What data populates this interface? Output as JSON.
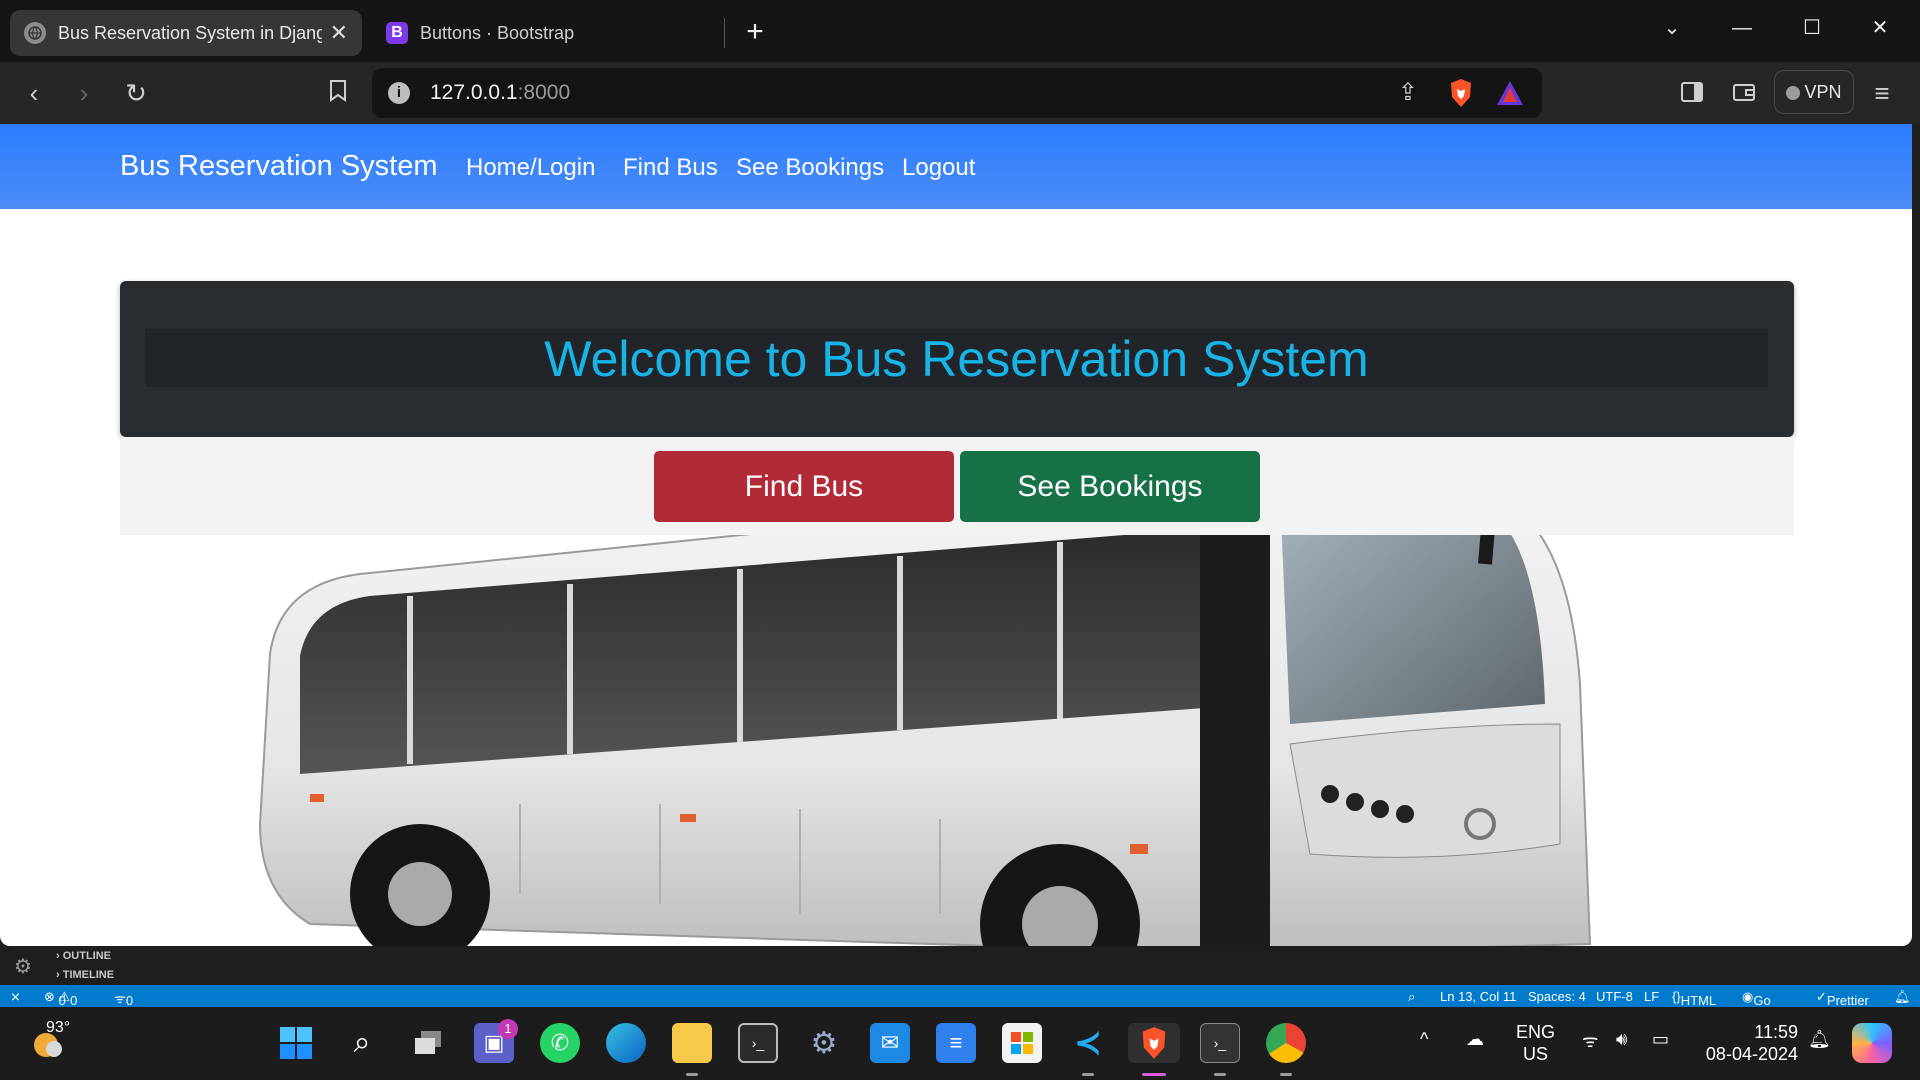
{
  "browser": {
    "tabs": [
      {
        "title": "Bus Reservation System in Djang",
        "active": true
      },
      {
        "title": "Buttons · Bootstrap",
        "active": false
      }
    ],
    "url_host": "127.0.0.1",
    "url_port": ":8000",
    "vpn_label": "VPN"
  },
  "page": {
    "brand": "Bus Reservation System",
    "nav": [
      "Home/Login",
      "Find Bus",
      "See Bookings",
      "Logout"
    ],
    "welcome": "Welcome to Bus Reservation System",
    "find_button": "Find Bus",
    "bookings_button": "See Bookings"
  },
  "vscode": {
    "sections": [
      "OUTLINE",
      "TIMELINE"
    ],
    "status_left": {
      "errors": "0",
      "warnings": "0",
      "ports": "0"
    },
    "status_right": [
      "Ln 13, Col 11",
      "Spaces: 4",
      "UTF-8",
      "LF",
      "HTML",
      "Go Live",
      "Prettier"
    ]
  },
  "taskbar": {
    "weather": "93°",
    "teams_badge": "1",
    "language": "ENG",
    "region": "US",
    "time": "11:59",
    "date": "08-04-2024"
  },
  "colors": {
    "navbar": "#3a86ff",
    "welcome_text": "#18b4e8",
    "find_btn": "#b02a37",
    "bookings_btn": "#167146"
  }
}
